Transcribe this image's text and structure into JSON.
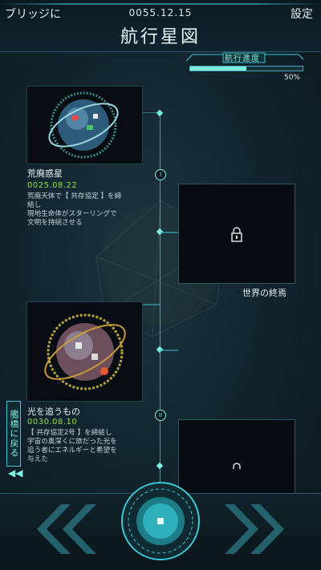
{
  "header": {
    "back_label": "ブリッジに",
    "date": "0055.12.15",
    "settings_label": "設定",
    "title": "航行星図"
  },
  "progress": {
    "label": "航行進度",
    "value_text": "50%",
    "fraction": 0.5
  },
  "cards": [
    {
      "title": "荒廃惑星",
      "date": "0025.08.22",
      "description": "荒廃天体で【 共存協定 】を締\n結し\n現地生命体がスターリングで\n文明を持続させる",
      "node_label": "I"
    },
    {
      "title": "光を追うもの",
      "date": "0030.08.10",
      "description": "【 共存協定2号 】を締結し\n宇宙の奥深くに旅だった光を\n追う者にエネルギーと希望を\n与えた",
      "node_label": "II"
    }
  ],
  "locked_cards": [
    {
      "title": "世界の終焉"
    },
    {
      "title": ""
    }
  ],
  "side_tab": {
    "label": "艦橋に戻る",
    "arrow": "◀◀"
  },
  "colors": {
    "accent": "#7ff0df",
    "date_green": "#8fdc47",
    "panel": "#070d12"
  },
  "icons": {
    "lock": "lock-icon",
    "prev": "double-chevron-left-icon",
    "next": "double-chevron-right-icon",
    "center": "center-button-icon"
  }
}
